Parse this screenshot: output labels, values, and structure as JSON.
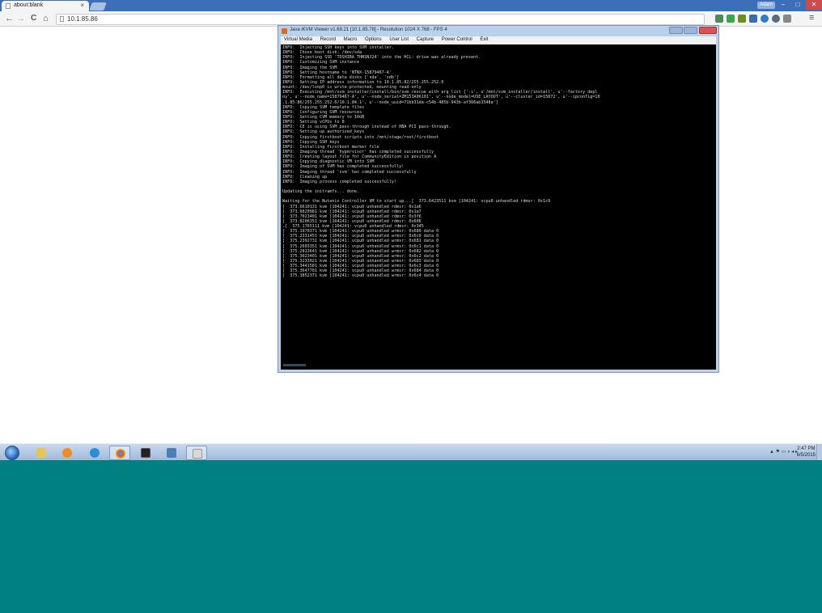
{
  "browser": {
    "tab_title": "about:blank",
    "tab_close": "×",
    "address": "10.1.85.86",
    "user_label": "Adam",
    "nav": {
      "back": "←",
      "forward": "→",
      "reload": "C",
      "home": "⌂"
    },
    "window_buttons": {
      "minimize": "–",
      "maximize": "□",
      "close": "✕"
    }
  },
  "kvm": {
    "title": "Java iKVM Viewer v1.69.21 [10.1.85.78] - Resolution 1024 X 768 - FPS 4",
    "menu": [
      "Virtual Media",
      "Record",
      "Macro",
      "Options",
      "User List",
      "Capture",
      "Power Control",
      "Exit"
    ],
    "console_lines": [
      "INFO:  Injecting SSH keys into SVM installer.",
      "INFO:  Chose boot disk: /dev/sda",
      "INFO:  Injecting SSD 'TOSHIBA THNSNJ24' into the HCL: drive was already present.",
      "INFO:  Customizing SVM instance",
      "INFO:  Imaging the SVM",
      "INFO:  Setting hostname to 'NTNX-15879467-A'",
      "INFO:  Formatting all data disks ['sda', 'sdb']",
      "INFO:  Setting IP address information to 10.1.85.82/255.255.252.0",
      "mount: /dev/loop0 is write-protected, mounting read-only",
      "INFO:  Executing /mnt/svm_installer/install/bin/svm_rescue with arg_list ['-i', u'/mnt/svm_installer/install', u'--factory_depl",
      "oy', u'--node_name=15879467-A', u'--node_serial=ZM153A06101', u'--node_model=USE_LAYOUT', u'--cluster_id=15872', u'--ipconfig=10",
      ".1.85.86/255.255.252.0/10.1.84.1', u'--node_uuid=71bb31da-c54b-485b-943b-af366ab3348a']",
      "INFO:  Copying SVM template files",
      "INFO:  Configuring SVM resources",
      "INFO:  Setting CVM memory to 16GB",
      "INFO:  Setting vCPUs to 8",
      "INFO:  CE is using SVM pass-through instead of HBA PCI pass-through.",
      "INFO:  Setting up authorized_keys",
      "INFO:  Copying firstboot scripts into /mnt/stage/root/firstboot",
      "INFO:  Copying SSH keys",
      "INFO:  Installing firstboot marker file",
      "INFO:  Imaging thread 'hypervisor' has completed successfully",
      "INFO:  Creating layout file for CommunityEdition in position A",
      "INFO:  Copying diagnostic VM into SVM",
      "INFO:  Imaging of SVM has completed successfully!",
      "INFO:  Imaging thread 'svm' has completed successfully",
      "INFO:  Cleaning up",
      "INFO:  Imaging process completed successfully!",
      "",
      "Updating the initramfs... done.",
      "",
      "Waiting for the Nutanix Controller VM to start up...[  373.6423511 kvm [104241: vcpu0 unhandled rdmsr: 0x1c9",
      "[  373.6610131 kvm [104241: vcpu0 unhandled rdmsr: 0x1a6",
      "[  373.6820981 kvm [104241: vcpu0 unhandled rdmsr: 0x1a7",
      "[  373.7023401 kvm [104241: vcpu0 unhandled rdmsr: 0x3f6",
      "[  373.8206351 kvm [104241: vcpu0 unhandled rdmsr: 0x606",
      ".[  375.1765111 kvm [104241: vcpu0 unhandled rdmsr: 0x345",
      "[  375.1970371 kvm [104241: vcpu0 unhandled wrmsr: 0x680 data 0",
      "[  375.2331451 kvm [104241: vcpu0 unhandled wrmsr: 0x6c0 data 0",
      "[  375.2392731 kvm [104241: vcpu0 unhandled wrmsr: 0x681 data 0",
      "[  375.2603351 kvm [104241: vcpu0 unhandled wrmsr: 0x6c1 data 0",
      "[  375.2813641 kvm [104241: vcpu0 unhandled wrmsr: 0x682 data 0",
      "[  375.3023401 kvm [104241: vcpu0 unhandled wrmsr: 0x6c2 data 0",
      "[  375.3233021 kvm [104241: vcpu0 unhandled wrmsr: 0x683 data 0",
      "[  375.3441581 kvm [104241: vcpu0 unhandled wrmsr: 0x6c3 data 0",
      "[  375.3647701 kvm [104241: vcpu0 unhandled wrmsr: 0x684 data 0",
      "[  375.3852371 kvm [104241: vcpu0 unhandled wrmsr: 0x6c4 data 0"
    ]
  },
  "taskbar": {
    "apps": [
      "windows-explorer",
      "media-player",
      "internet-explorer",
      "google-chrome",
      "terminal",
      "remote-desktop",
      "java-kvm"
    ],
    "tray_text": "▲ ⚑ ▭ ◖ ◂ ▸",
    "clock_time": "2:47 PM",
    "clock_date": "6/5/2015"
  },
  "colors": {
    "desktop": "#008080",
    "tabstrip": "#3c6fb7",
    "console_bg": "#000000"
  }
}
